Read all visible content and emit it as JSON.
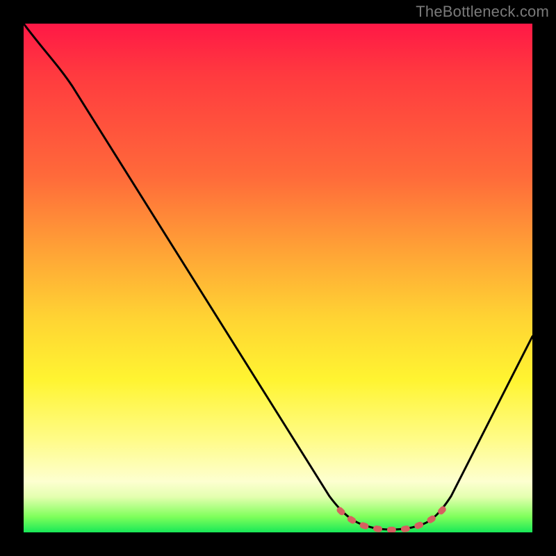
{
  "watermark": "TheBottleneck.com",
  "chart_data": {
    "type": "line",
    "title": "",
    "xlabel": "",
    "ylabel": "",
    "xlim": [
      0,
      100
    ],
    "ylim": [
      0,
      100
    ],
    "x": [
      0,
      5,
      10,
      15,
      20,
      25,
      30,
      35,
      40,
      45,
      50,
      55,
      60,
      62,
      65,
      68,
      70,
      72,
      75,
      78,
      80,
      85,
      90,
      95,
      100
    ],
    "values": [
      100,
      94,
      88,
      81,
      74,
      67,
      60,
      53,
      46,
      39,
      32,
      25,
      17,
      11,
      6,
      3,
      1,
      0.5,
      0.4,
      0.5,
      1,
      5,
      14,
      26,
      39
    ],
    "gradient_stops": [
      {
        "pos": 0,
        "color": "#ff1846"
      },
      {
        "pos": 10,
        "color": "#ff3a3f"
      },
      {
        "pos": 30,
        "color": "#ff6a3a"
      },
      {
        "pos": 45,
        "color": "#ffa436"
      },
      {
        "pos": 58,
        "color": "#ffd433"
      },
      {
        "pos": 70,
        "color": "#fff431"
      },
      {
        "pos": 82,
        "color": "#fffc8a"
      },
      {
        "pos": 90,
        "color": "#fdffd0"
      },
      {
        "pos": 93,
        "color": "#e4ffb0"
      },
      {
        "pos": 97,
        "color": "#7dff5a"
      },
      {
        "pos": 100,
        "color": "#18e858"
      }
    ],
    "highlight_segment": {
      "color": "#d45a5a",
      "x_start": 62,
      "x_end": 80
    },
    "curve_color": "#000000"
  }
}
